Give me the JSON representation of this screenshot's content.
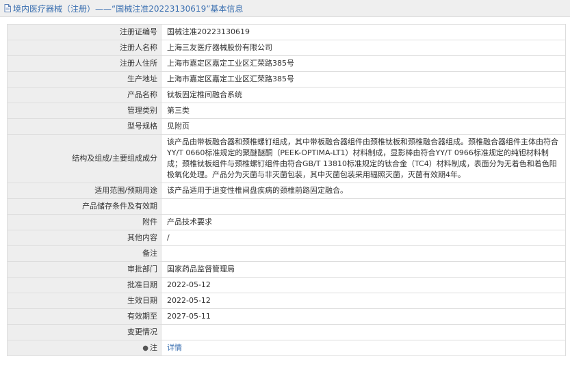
{
  "header": {
    "title": "境内医疗器械（注册）——“国械注准20223130619”基本信息"
  },
  "rows": [
    {
      "label": "注册证编号",
      "value": "国械注准20223130619"
    },
    {
      "label": "注册人名称",
      "value": "上海三友医疗器械股份有限公司"
    },
    {
      "label": "注册人住所",
      "value": "上海市嘉定区嘉定工业区汇荣路385号"
    },
    {
      "label": "生产地址",
      "value": "上海市嘉定区嘉定工业区汇荣路385号"
    },
    {
      "label": "产品名称",
      "value": "钛板固定椎间融合系统"
    },
    {
      "label": "管理类别",
      "value": "第三类"
    },
    {
      "label": "型号规格",
      "value": "见附页"
    },
    {
      "label": "结构及组成/主要组成成分",
      "value": "该产品由带板融合器和颈椎螺钉组成，其中带板融合器组件由颈椎钛板和颈椎融合器组成。颈椎融合器组件主体由符合YY/T 0660标准规定的聚醚醚酮（PEEK-OPTIMA-LT1）材料制成，显影棒由符合YY/T 0966标准规定的纯钽材料制成；颈椎钛板组件与颈椎螺钉组件由符合GB/T 13810标准规定的钛合金（TC4）材料制成，表面分为无着色和着色阳极氧化处理。产品分为灭菌与非灭菌包装，其中灭菌包装采用辐照灭菌，灭菌有效期4年。"
    },
    {
      "label": "适用范围/预期用途",
      "value": "该产品适用于退变性椎间盘疾病的颈椎前路固定融合。"
    },
    {
      "label": "产品储存条件及有效期",
      "value": ""
    },
    {
      "label": "附件",
      "value": "产品技术要求"
    },
    {
      "label": "其他内容",
      "value": "/"
    },
    {
      "label": "备注",
      "value": ""
    },
    {
      "label": "审批部门",
      "value": "国家药品监督管理局"
    },
    {
      "label": "批准日期",
      "value": "2022-05-12"
    },
    {
      "label": "生效日期",
      "value": "2022-05-12"
    },
    {
      "label": "有效期至",
      "value": "2027-05-11"
    },
    {
      "label": "变更情况",
      "value": ""
    }
  ],
  "note": {
    "label": "注",
    "icon": "pin-icon",
    "link": "详情"
  }
}
